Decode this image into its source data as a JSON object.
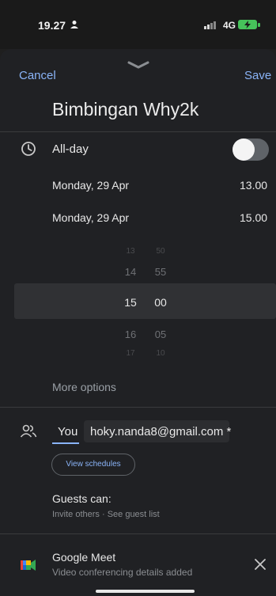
{
  "status_bar": {
    "time": "19.27",
    "network": "4G"
  },
  "header": {
    "cancel_label": "Cancel",
    "save_label": "Save"
  },
  "event": {
    "title": "Bimbingan Why2k"
  },
  "schedule": {
    "all_day_label": "All-day",
    "all_day_enabled": false,
    "start": {
      "date": "Monday, 29 Apr",
      "time": "13.00"
    },
    "end": {
      "date": "Monday, 29 Apr",
      "time": "15.00"
    }
  },
  "time_picker": {
    "hours": [
      "13",
      "14",
      "15",
      "16",
      "17"
    ],
    "minutes": [
      "50",
      "55",
      "00",
      "05",
      "10"
    ],
    "selected_hour": "15",
    "selected_minute": "00"
  },
  "more_options_label": "More options",
  "guests": {
    "chips": [
      "You",
      "hoky.nanda8@gmail.com *"
    ],
    "view_schedules_label": "View schedules",
    "guests_can_label": "Guests can:",
    "permissions": "Invite others · See guest list"
  },
  "conferencing": {
    "title": "Google Meet",
    "subtitle": "Video conferencing details added"
  },
  "colors": {
    "background": "#202124",
    "accent": "#8ab4f8",
    "battery": "#46c35a"
  },
  "icons": {
    "clock": "clock-icon",
    "people": "people-icon",
    "meet": "google-meet-icon",
    "close": "close-icon",
    "handle": "chevron-down-icon"
  }
}
